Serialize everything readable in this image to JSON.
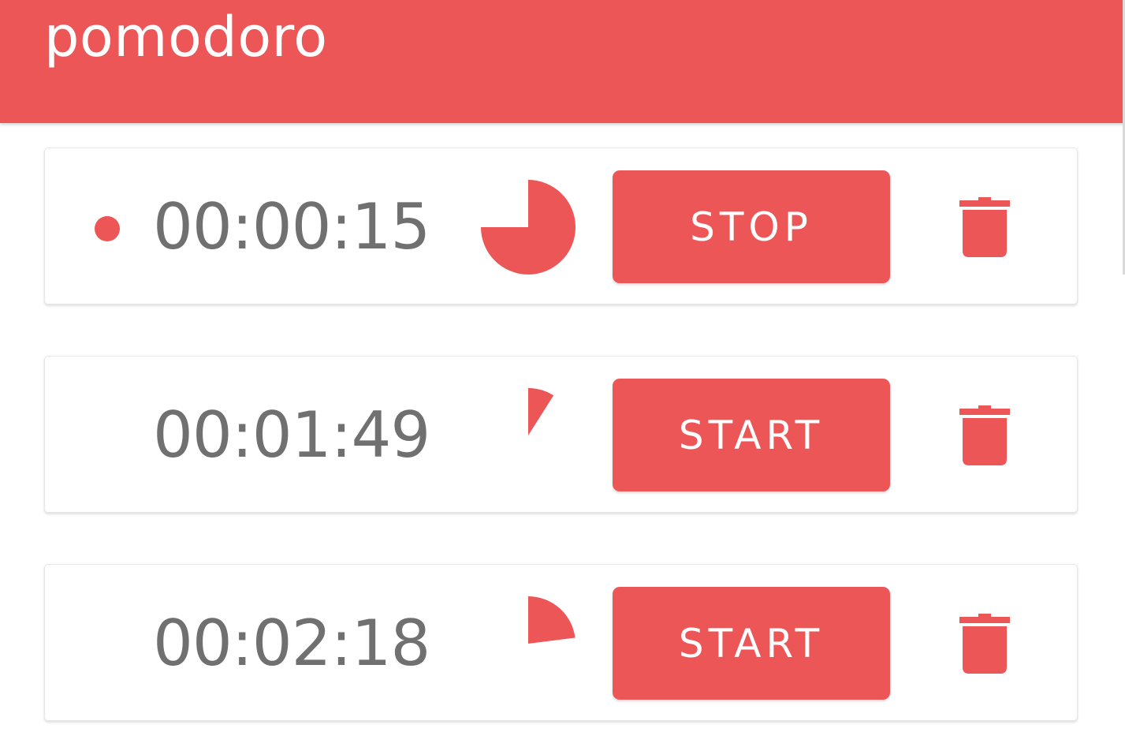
{
  "app": {
    "title": "pomodoro"
  },
  "colors": {
    "accent": "#ec5657",
    "time_text": "#707070",
    "card_bg": "#ffffff"
  },
  "timers": [
    {
      "time": "00:00:15",
      "button_label": "STOP",
      "running": true,
      "progress": 0.75,
      "icon": "trash-icon"
    },
    {
      "time": "00:01:49",
      "button_label": "START",
      "running": false,
      "progress": 0.09,
      "icon": "trash-icon"
    },
    {
      "time": "00:02:18",
      "button_label": "START",
      "running": false,
      "progress": 0.23,
      "icon": "trash-icon"
    }
  ]
}
